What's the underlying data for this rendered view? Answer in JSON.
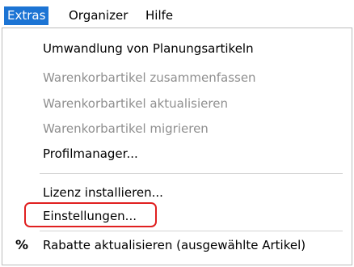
{
  "menubar": {
    "items": [
      {
        "label": "Extras",
        "active": true
      },
      {
        "label": "Organizer",
        "active": false
      },
      {
        "label": "Hilfe",
        "active": false
      }
    ]
  },
  "dropdown": {
    "items": [
      {
        "label": "Umwandlung von Planungsartikeln",
        "enabled": true
      },
      {
        "label": "Warenkorbartikel zusammenfassen",
        "enabled": false
      },
      {
        "label": "Warenkorbartikel aktualisieren",
        "enabled": false
      },
      {
        "label": "Warenkorbartikel migrieren",
        "enabled": false
      },
      {
        "label": "Profilmanager...",
        "enabled": true
      },
      {
        "label": "Lizenz installieren...",
        "enabled": true
      },
      {
        "label": "Einstellungen...",
        "enabled": true,
        "highlighted": true
      },
      {
        "label": "Rabatte aktualisieren (ausgewählte Artikel)",
        "enabled": true,
        "icon_glyph": "%"
      }
    ]
  },
  "colors": {
    "menubar_active_bg": "#1c74d4",
    "highlight_border": "#e02020",
    "disabled_text": "#8f8f8f"
  }
}
